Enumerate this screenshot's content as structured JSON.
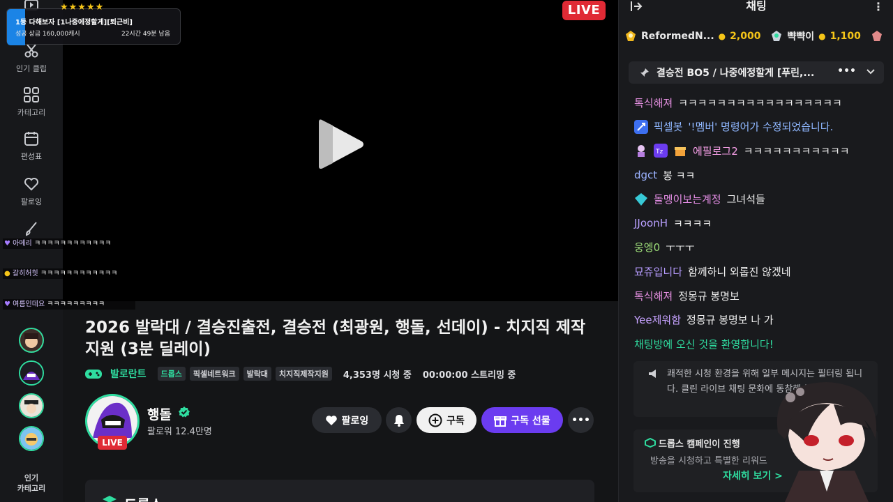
{
  "sidebar": {
    "items": [
      {
        "label": "인기 클립"
      },
      {
        "label": "카테고리"
      },
      {
        "label": "편성표"
      },
      {
        "label": "팔로잉"
      }
    ],
    "category_label": "인기\n카테고리"
  },
  "player": {
    "live_badge": "LIVE",
    "donation_card": {
      "title": "1등 다해보자 [1나중에정할게][퇴근비]",
      "sub": "성공 상금 160,000캐시",
      "time": "22시간 49분 남음",
      "stars": "★★★★★"
    },
    "overlay_chat": [
      {
        "name": "아메리",
        "text": "ㅋㅋㅋㅋㅋㅋㅋㅋㅋㅋㅋㅋ"
      },
      {
        "name": "갈히허힛",
        "text": "ㅋㅋㅋㅋㅋㅋㅋㅋㅋㅋㅋㅋ"
      },
      {
        "name": "여름인데요",
        "text": "ㅋㅋㅋㅋㅋㅋㅋㅋㅋ"
      }
    ]
  },
  "stream": {
    "title": "2026 발락대 / 결승진출전, 결승전 (최광원, 행돌, 선데이) - 치지직 제작지원 (3분 딜레이)",
    "game": "발로란트",
    "tags": [
      "드롭스",
      "픽셀네트워크",
      "발락대",
      "치지직제작지원"
    ],
    "viewers": "4,353명 시청 중",
    "uptime": "00:00:00 스트리밍 중"
  },
  "channel": {
    "name": "행돌",
    "followers": "팔로워 12.4만명",
    "live_badge": "LIVE",
    "follow_label": "팔로잉",
    "subscribe_label": "구독",
    "gift_label": "구독 선물",
    "more_label": "•••"
  },
  "bottom_card": {
    "label": "드롭스"
  },
  "chat": {
    "title": "채팅",
    "donors": [
      {
        "name": "ReformedN...",
        "amount": "2,000"
      },
      {
        "name": "뺙뺙이",
        "amount": "1,100"
      }
    ],
    "pinned": "결승전 BO5 / 나중에정할게 [푸린,...",
    "pinned_more": "•••",
    "messages": [
      {
        "nick": "톡식해져",
        "color": "#e48fe0",
        "text": "ㅋㅋㅋㅋㅋㅋㅋㅋㅋㅋㅋㅋㅋㅋㅋㅋㅋ"
      },
      {
        "nick": "픽셀봇",
        "color": "#8fb7ff",
        "text": "'!멤버' 명령어가 수정되었습니다.",
        "text_color": "#8fb7ff"
      },
      {
        "nick": "에필로그2",
        "color": "#f7a0e8",
        "text": "ㅋㅋㅋㅋㅋㅋㅋㅋㅋㅋㅋ"
      },
      {
        "nick": "dgct",
        "color": "#9bb2ff",
        "text": "봉 ㅋㅋ"
      },
      {
        "nick": "돌멩이보는계정",
        "color": "#e78fe8",
        "text": "그녀석들"
      },
      {
        "nick": "JJoonH",
        "color": "#b9a0ff",
        "text": "ㅋㅋㅋㅋ"
      },
      {
        "nick": "웅엥0",
        "color": "#9fe07a",
        "text": "ㅜㅜㅜ"
      },
      {
        "nick": "묘쥬입니다",
        "color": "#b79cff",
        "text": "함께하니 외롭진 않겠네"
      },
      {
        "nick": "톡식해져",
        "color": "#e48fe0",
        "text": "정몽규 봉명보"
      },
      {
        "nick": "Yee제워함",
        "color": "#c6a2ff",
        "text": "정몽규 봉명보 나 가"
      }
    ],
    "welcome": "채팅방에 오신 것을 환영합니다!",
    "notice": "쾌적한 시청 환경을 위해 일부 메시지는 필터링 됩니다. 클린 라이브 채팅 문화에 동참해 주세요.",
    "campaign_title": "드롭스 캠페인이 진행",
    "campaign_desc": "방송을 시청하고 특별한 리워드",
    "campaign_link": "자세히 보기 >"
  },
  "colors": {
    "accent": "#2fdda0",
    "live": "#e02a35",
    "gift": "#6b3cf0",
    "gold": "#f5c518"
  }
}
